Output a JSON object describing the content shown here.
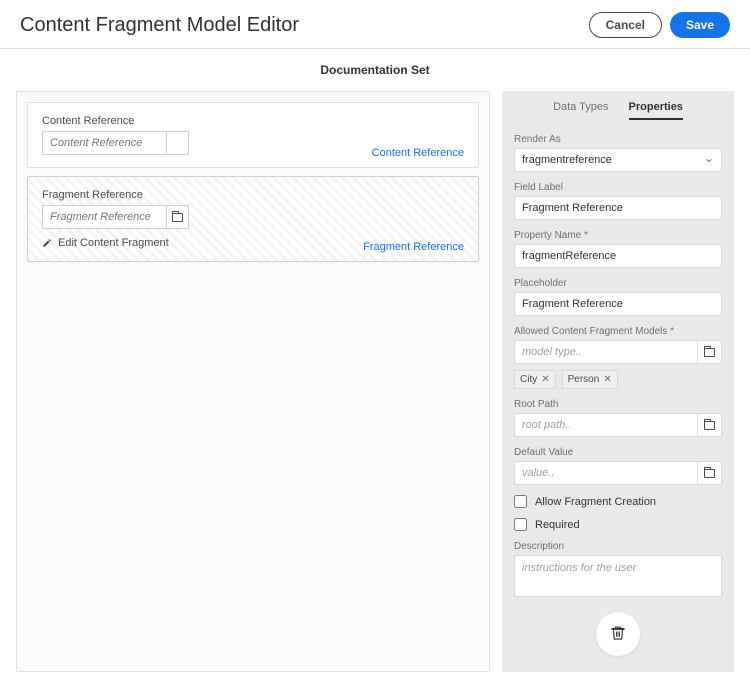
{
  "header": {
    "title": "Content Fragment Model Editor",
    "cancel": "Cancel",
    "save": "Save"
  },
  "subtitle": "Documentation Set",
  "canvas": {
    "fields": [
      {
        "label": "Content Reference",
        "placeholder": "Content Reference",
        "type_tag": "Content Reference"
      },
      {
        "label": "Fragment Reference",
        "placeholder": "Fragment Reference",
        "type_tag": "Fragment Reference",
        "edit_label": "Edit Content Fragment"
      }
    ]
  },
  "tabs": {
    "data_types": "Data Types",
    "properties": "Properties"
  },
  "props": {
    "render_as": {
      "label": "Render As",
      "value": "fragmentreference"
    },
    "field_label": {
      "label": "Field Label",
      "value": "Fragment Reference"
    },
    "property_name": {
      "label": "Property Name *",
      "value": "fragmentReference"
    },
    "placeholder": {
      "label": "Placeholder",
      "value": "Fragment Reference"
    },
    "allowed_models": {
      "label": "Allowed Content Fragment Models *",
      "placeholder": "model type..",
      "tags": [
        "City",
        "Person"
      ]
    },
    "root_path": {
      "label": "Root Path",
      "placeholder": "root path.."
    },
    "default_value": {
      "label": "Default Value",
      "placeholder": "value.."
    },
    "allow_creation": {
      "label": "Allow Fragment Creation"
    },
    "required": {
      "label": "Required"
    },
    "description": {
      "label": "Description",
      "placeholder": "instructions for the user"
    }
  }
}
